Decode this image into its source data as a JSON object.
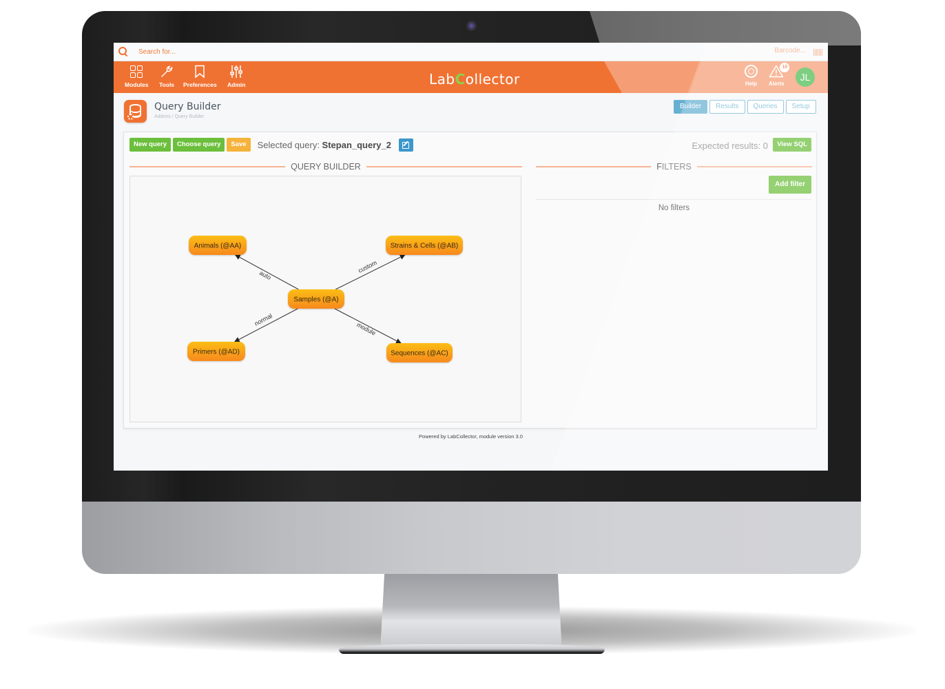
{
  "app": {
    "name_prefix": "Lab",
    "name_c": "C",
    "name_suffix": "ollector"
  },
  "searchbar": {
    "search_placeholder": "Search for...",
    "barcode_placeholder": "Barcode..."
  },
  "nav": {
    "items": [
      {
        "label": "Modules",
        "icon": "grid-icon"
      },
      {
        "label": "Tools",
        "icon": "wrench-icon"
      },
      {
        "label": "Preferences",
        "icon": "bookmark-icon"
      },
      {
        "label": "Admin",
        "icon": "sliders-icon"
      }
    ],
    "help_label": "Help",
    "alerts_label": "Alerts",
    "alerts_count": "10",
    "avatar_initials": "JL"
  },
  "page": {
    "title": "Query Builder",
    "breadcrumb": "Addons / Query Builder",
    "tabs": [
      {
        "label": "Builder",
        "active": true
      },
      {
        "label": "Results",
        "active": false
      },
      {
        "label": "Queries",
        "active": false
      },
      {
        "label": "Setup",
        "active": false
      }
    ]
  },
  "toolbar": {
    "new_query": "New query",
    "choose_query": "Choose query",
    "save": "Save",
    "selected_label": "Selected query: ",
    "selected_value": "Stepan_query_2",
    "expected_results": "Expected results: 0",
    "view_sql": "View SQL"
  },
  "builder": {
    "section_title": "QUERY BUILDER",
    "nodes": [
      {
        "id": "A",
        "label": "Samples (@A)"
      },
      {
        "id": "AA",
        "label": "Animals (@AA)"
      },
      {
        "id": "AB",
        "label": "Strains & Cells (@AB)"
      },
      {
        "id": "AC",
        "label": "Sequences (@AC)"
      },
      {
        "id": "AD",
        "label": "Primers (@AD)"
      }
    ],
    "edges": [
      {
        "from": "A",
        "to": "AA",
        "label": "auto"
      },
      {
        "from": "A",
        "to": "AB",
        "label": "custom"
      },
      {
        "from": "A",
        "to": "AC",
        "label": "module"
      },
      {
        "from": "A",
        "to": "AD",
        "label": "normal"
      }
    ]
  },
  "filters": {
    "section_title": "FILTERS",
    "add_filter": "Add filter",
    "empty_text": "No filters"
  },
  "footer": {
    "text": "Powered by LabCollector, module version 3.0"
  },
  "colors": {
    "brand_orange": "#f07233",
    "accent_green": "#6cbf3c",
    "save_orange": "#f5b33b",
    "tab_blue": "#66b0d2",
    "node_orange": "#f9a21b"
  }
}
